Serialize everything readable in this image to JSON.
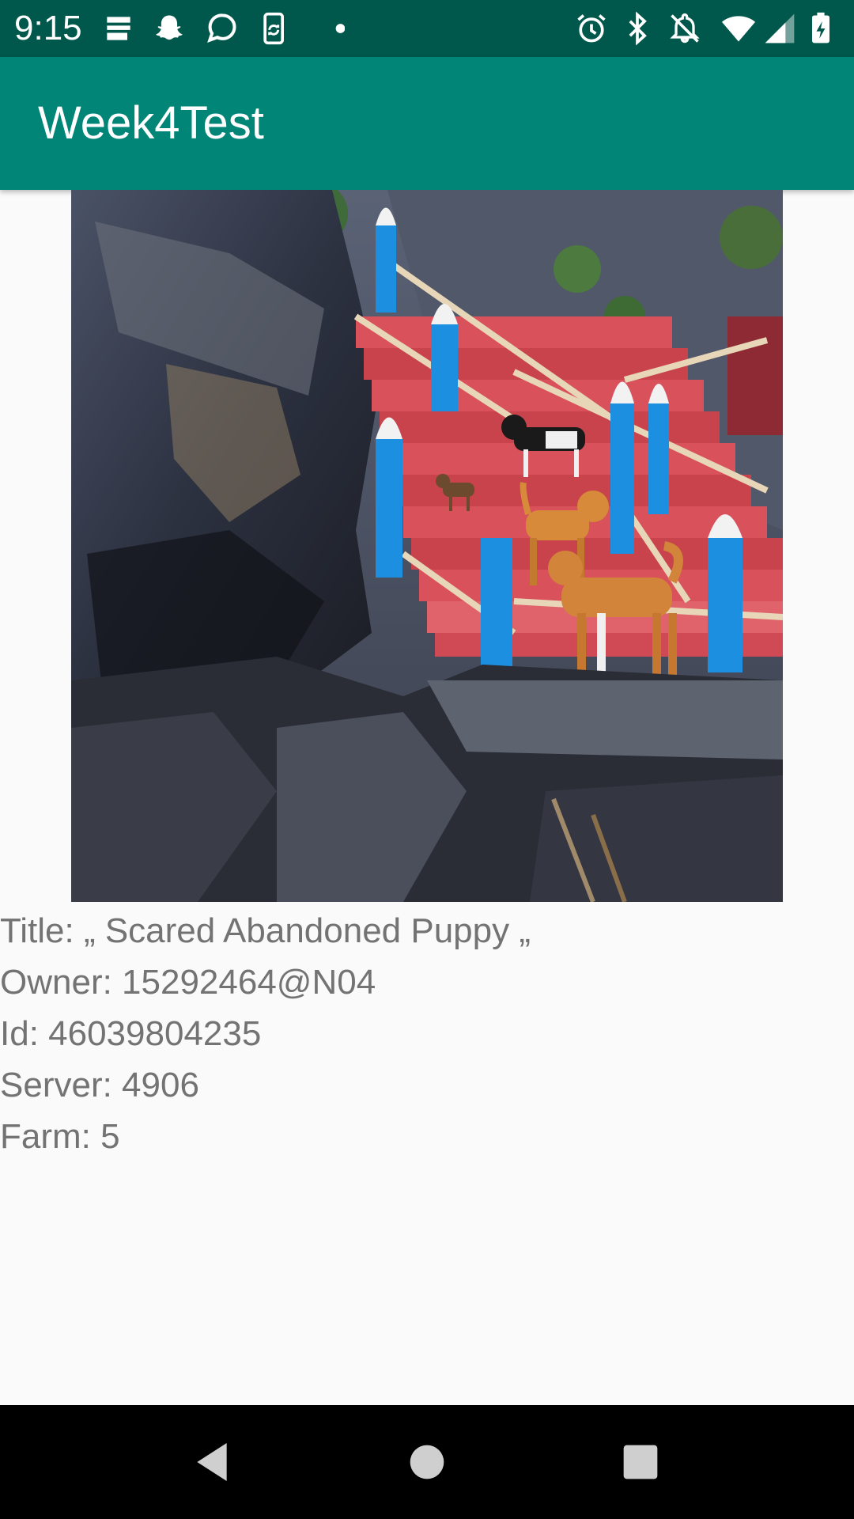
{
  "status_bar": {
    "time": "9:15",
    "left_icons": [
      "notes-icon",
      "snapchat-icon",
      "chat-bubble-icon",
      "phone-sync-icon",
      "dot-icon"
    ],
    "right_icons": [
      "alarm-icon",
      "bluetooth-icon",
      "notifications-off-icon",
      "wifi-icon",
      "cell-signal-icon",
      "battery-charging-icon"
    ]
  },
  "app_bar": {
    "title": "Week4Test"
  },
  "photo": {
    "description_icon": "photo-image"
  },
  "info": {
    "title_line": "Title: „ Scared Abandoned Puppy „",
    "owner_line": "Owner: 15292464@N04",
    "id_line": "Id: 46039804235",
    "server_line": "Server: 4906",
    "farm_line": "Farm: 5"
  },
  "nav_bar": {
    "buttons": [
      "back-icon",
      "home-icon",
      "recents-icon"
    ]
  },
  "colors": {
    "status_bar": "#00574b",
    "app_bar": "#008577",
    "text": "#737373",
    "background": "#fafafa"
  }
}
